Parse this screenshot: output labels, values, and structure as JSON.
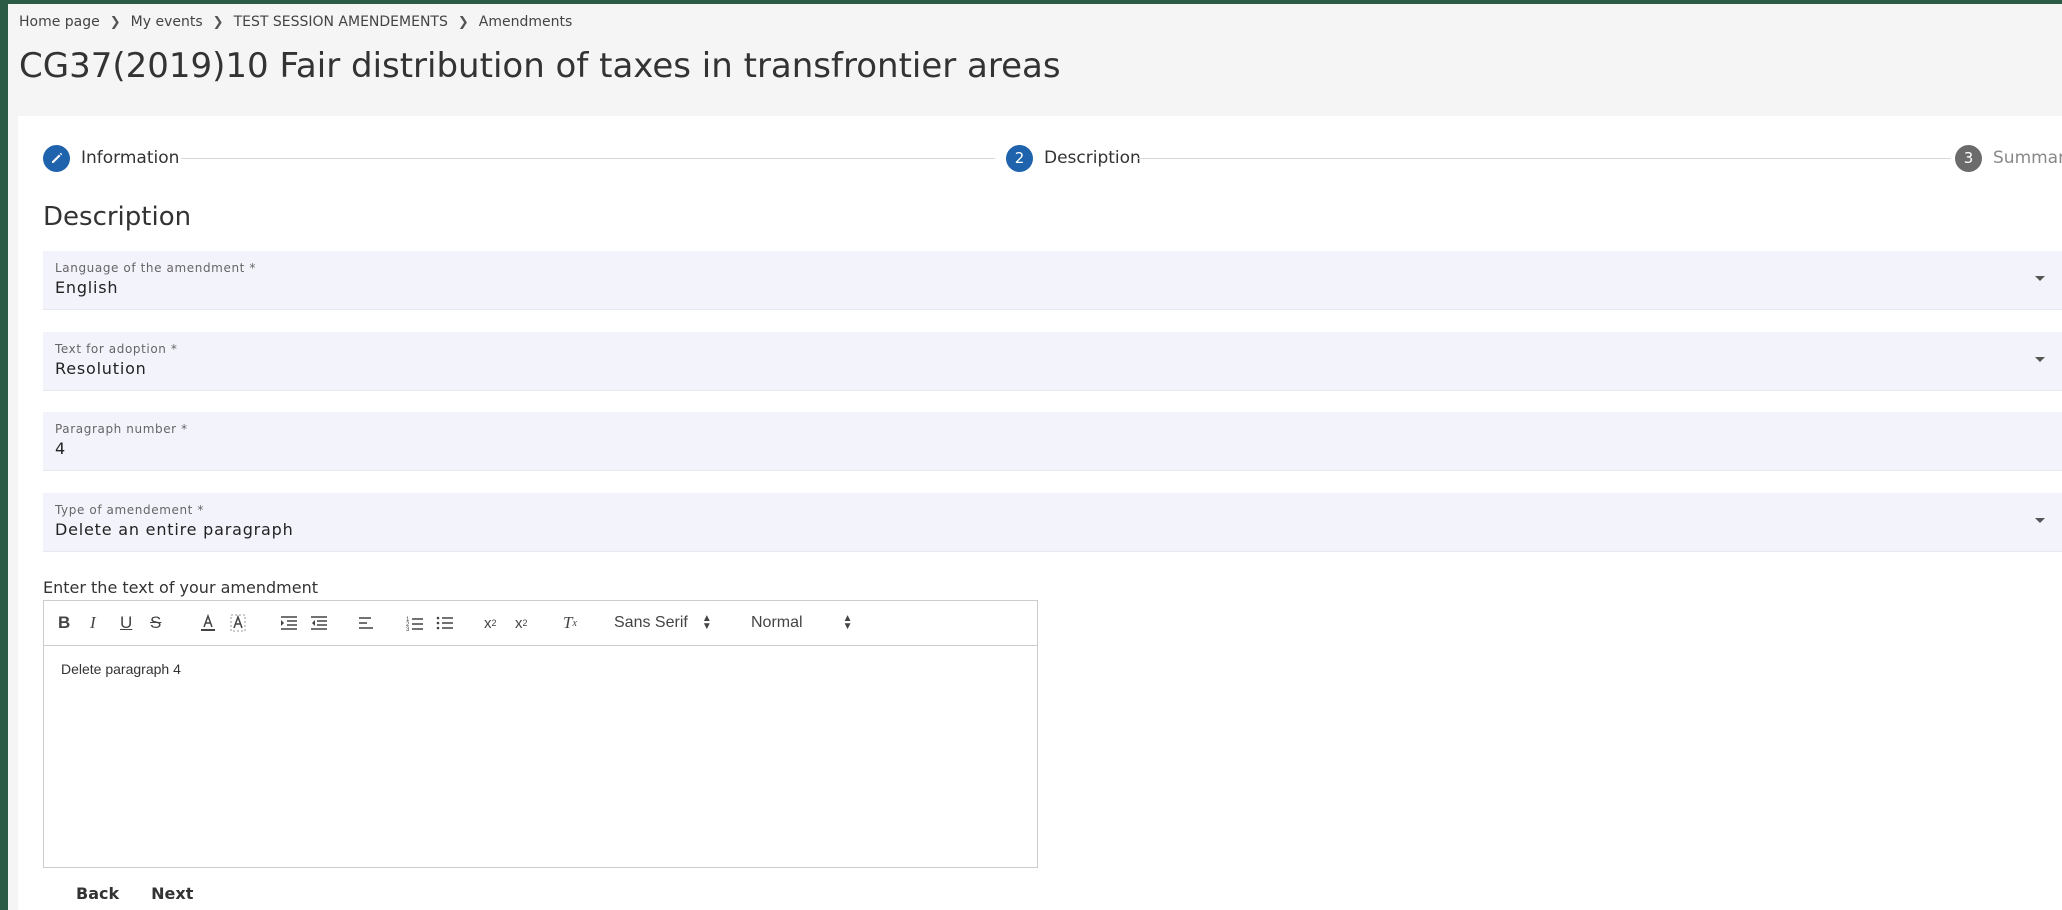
{
  "breadcrumb": {
    "items": [
      "Home page",
      "My events",
      "TEST SESSION AMENDEMENTS",
      "Amendments"
    ]
  },
  "page": {
    "title": "CG37(2019)10 Fair distribution of taxes in transfrontier areas"
  },
  "stepper": {
    "steps": [
      {
        "number": "",
        "label": "Information",
        "icon": "pencil-icon"
      },
      {
        "number": "2",
        "label": "Description"
      },
      {
        "number": "3",
        "label": "Summary"
      }
    ]
  },
  "section": {
    "title": "Description"
  },
  "fields": {
    "language": {
      "label": "Language of the amendment *",
      "value": "English"
    },
    "text_for_adoption": {
      "label": "Text for adoption *",
      "value": "Resolution"
    },
    "paragraph_number": {
      "label": "Paragraph number *",
      "value": "4"
    },
    "type_of_amendment": {
      "label": "Type of amendement *",
      "value": "Delete an entire paragraph"
    }
  },
  "editor": {
    "label": "Enter the text of your amendment",
    "font_select": "Sans Serif",
    "size_select": "Normal",
    "content": "Delete paragraph 4"
  },
  "actions": {
    "back_label": "Back",
    "next_label": "Next"
  },
  "colors": {
    "accent": "#1f63ad",
    "field_bg": "#f3f3fc",
    "background": "#2b5a45"
  }
}
